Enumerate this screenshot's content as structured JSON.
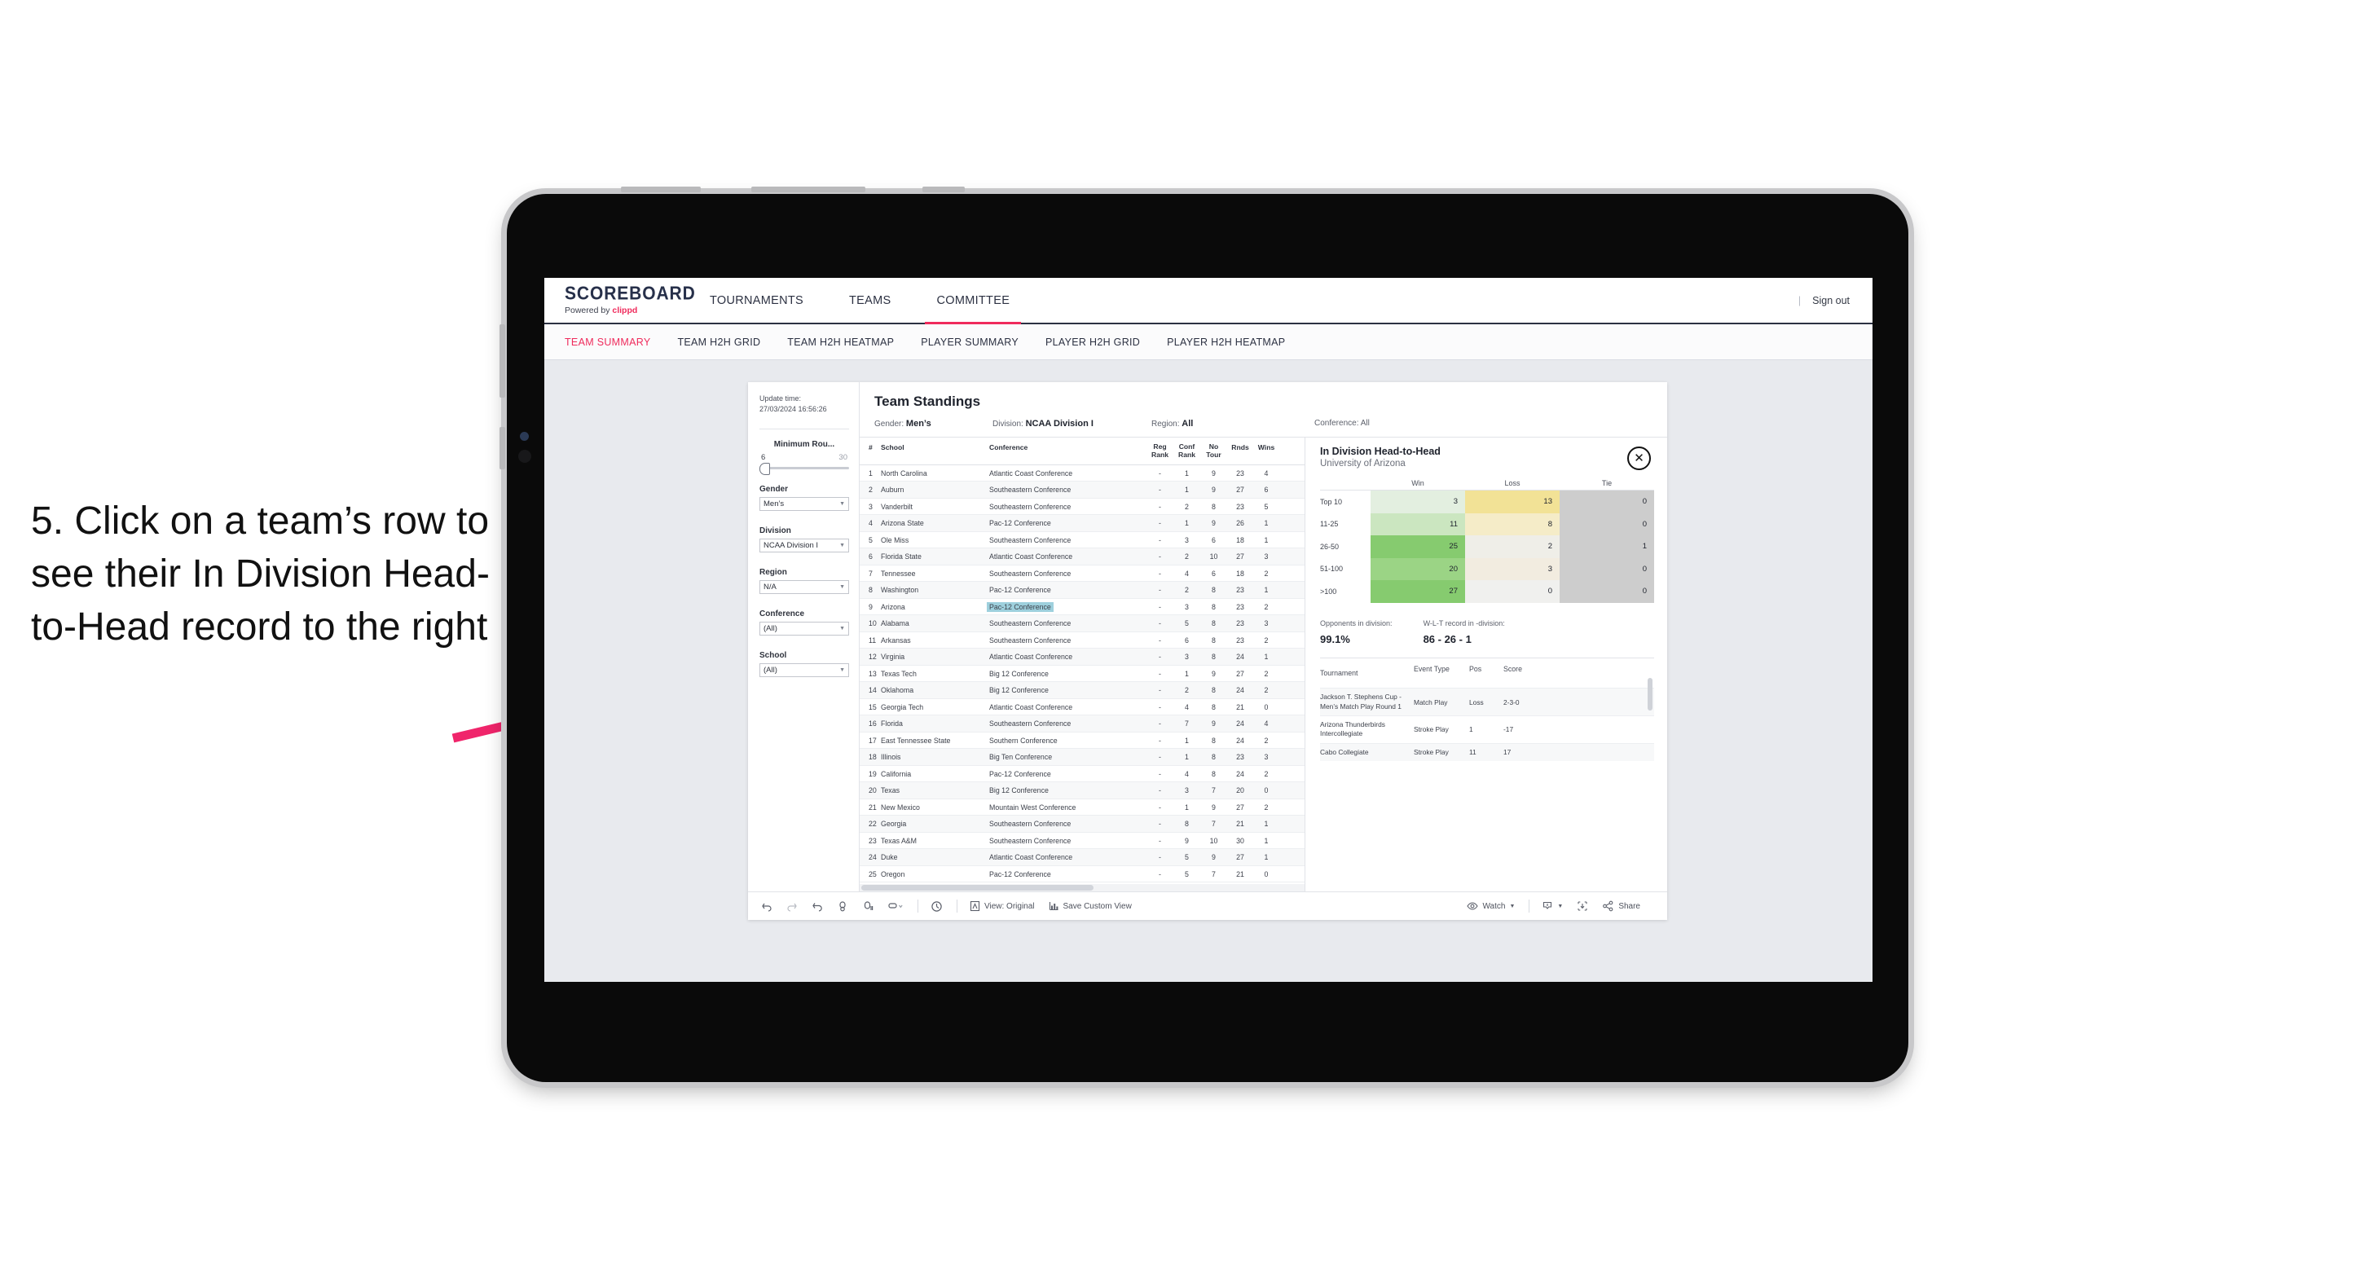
{
  "annotation": {
    "text": "5. Click on a team’s row to see their In Division Head-to-Head record to the right",
    "arrow_color": "#f0256b"
  },
  "topnav": {
    "logo_main": "SCOREBOARD",
    "logo_sub_prefix": "Powered by ",
    "logo_sub_brand": "clippd",
    "items": [
      {
        "label": "TOURNAMENTS",
        "active": false
      },
      {
        "label": "TEAMS",
        "active": false
      },
      {
        "label": "COMMITTEE",
        "active": true
      }
    ],
    "divider": "|",
    "sign_out": "Sign out",
    "accent": "#ef2b5c"
  },
  "subnav": {
    "items": [
      {
        "label": "TEAM SUMMARY",
        "active": true
      },
      {
        "label": "TEAM H2H GRID",
        "active": false
      },
      {
        "label": "TEAM H2H HEATMAP",
        "active": false
      },
      {
        "label": "PLAYER SUMMARY",
        "active": false
      },
      {
        "label": "PLAYER H2H GRID",
        "active": false
      },
      {
        "label": "PLAYER H2H HEATMAP",
        "active": false
      }
    ]
  },
  "filters": {
    "update_time_label": "Update time:",
    "update_time_value": "27/03/2024 16:56:26",
    "slider": {
      "title": "Minimum Rou...",
      "min": "6",
      "max": "30"
    },
    "groups": [
      {
        "label": "Gender",
        "value": "Men’s"
      },
      {
        "label": "Division",
        "value": "NCAA Division I"
      },
      {
        "label": "Region",
        "value": "N/A"
      },
      {
        "label": "Conference",
        "value": "(All)"
      },
      {
        "label": "School",
        "value": "(All)"
      }
    ]
  },
  "standings": {
    "title": "Team Standings",
    "meta": [
      {
        "label": "Gender: ",
        "value": "Men’s"
      },
      {
        "label": "Division: ",
        "value": "NCAA Division I"
      },
      {
        "label": "Region: ",
        "value": "All"
      },
      {
        "label": "Conference: ",
        "value": "All"
      }
    ],
    "columns": [
      "#",
      "School",
      "Conference",
      "Reg Rank",
      "Conf Rank",
      "No Tour",
      "Rnds",
      "Wins"
    ],
    "rows": [
      {
        "rank": "1",
        "school": "North Carolina",
        "conference": "Atlantic Coast Conference",
        "reg": "-",
        "conf": "1",
        "notour": "9",
        "rnds": "23",
        "wins": "4",
        "selected": false
      },
      {
        "rank": "2",
        "school": "Auburn",
        "conference": "Southeastern Conference",
        "reg": "-",
        "conf": "1",
        "notour": "9",
        "rnds": "27",
        "wins": "6",
        "selected": false
      },
      {
        "rank": "3",
        "school": "Vanderbilt",
        "conference": "Southeastern Conference",
        "reg": "-",
        "conf": "2",
        "notour": "8",
        "rnds": "23",
        "wins": "5",
        "selected": false
      },
      {
        "rank": "4",
        "school": "Arizona State",
        "conference": "Pac-12 Conference",
        "reg": "-",
        "conf": "1",
        "notour": "9",
        "rnds": "26",
        "wins": "1",
        "selected": false
      },
      {
        "rank": "5",
        "school": "Ole Miss",
        "conference": "Southeastern Conference",
        "reg": "-",
        "conf": "3",
        "notour": "6",
        "rnds": "18",
        "wins": "1",
        "selected": false
      },
      {
        "rank": "6",
        "school": "Florida State",
        "conference": "Atlantic Coast Conference",
        "reg": "-",
        "conf": "2",
        "notour": "10",
        "rnds": "27",
        "wins": "3",
        "selected": false
      },
      {
        "rank": "7",
        "school": "Tennessee",
        "conference": "Southeastern Conference",
        "reg": "-",
        "conf": "4",
        "notour": "6",
        "rnds": "18",
        "wins": "2",
        "selected": false
      },
      {
        "rank": "8",
        "school": "Washington",
        "conference": "Pac-12 Conference",
        "reg": "-",
        "conf": "2",
        "notour": "8",
        "rnds": "23",
        "wins": "1",
        "selected": false
      },
      {
        "rank": "9",
        "school": "Arizona",
        "conference": "Pac-12 Conference",
        "reg": "-",
        "conf": "3",
        "notour": "8",
        "rnds": "23",
        "wins": "2",
        "selected": true
      },
      {
        "rank": "10",
        "school": "Alabama",
        "conference": "Southeastern Conference",
        "reg": "-",
        "conf": "5",
        "notour": "8",
        "rnds": "23",
        "wins": "3",
        "selected": false
      },
      {
        "rank": "11",
        "school": "Arkansas",
        "conference": "Southeastern Conference",
        "reg": "-",
        "conf": "6",
        "notour": "8",
        "rnds": "23",
        "wins": "2",
        "selected": false
      },
      {
        "rank": "12",
        "school": "Virginia",
        "conference": "Atlantic Coast Conference",
        "reg": "-",
        "conf": "3",
        "notour": "8",
        "rnds": "24",
        "wins": "1",
        "selected": false
      },
      {
        "rank": "13",
        "school": "Texas Tech",
        "conference": "Big 12 Conference",
        "reg": "-",
        "conf": "1",
        "notour": "9",
        "rnds": "27",
        "wins": "2",
        "selected": false
      },
      {
        "rank": "14",
        "school": "Oklahoma",
        "conference": "Big 12 Conference",
        "reg": "-",
        "conf": "2",
        "notour": "8",
        "rnds": "24",
        "wins": "2",
        "selected": false
      },
      {
        "rank": "15",
        "school": "Georgia Tech",
        "conference": "Atlantic Coast Conference",
        "reg": "-",
        "conf": "4",
        "notour": "8",
        "rnds": "21",
        "wins": "0",
        "selected": false
      },
      {
        "rank": "16",
        "school": "Florida",
        "conference": "Southeastern Conference",
        "reg": "-",
        "conf": "7",
        "notour": "9",
        "rnds": "24",
        "wins": "4",
        "selected": false
      },
      {
        "rank": "17",
        "school": "East Tennessee State",
        "conference": "Southern Conference",
        "reg": "-",
        "conf": "1",
        "notour": "8",
        "rnds": "24",
        "wins": "2",
        "selected": false
      },
      {
        "rank": "18",
        "school": "Illinois",
        "conference": "Big Ten Conference",
        "reg": "-",
        "conf": "1",
        "notour": "8",
        "rnds": "23",
        "wins": "3",
        "selected": false
      },
      {
        "rank": "19",
        "school": "California",
        "conference": "Pac-12 Conference",
        "reg": "-",
        "conf": "4",
        "notour": "8",
        "rnds": "24",
        "wins": "2",
        "selected": false
      },
      {
        "rank": "20",
        "school": "Texas",
        "conference": "Big 12 Conference",
        "reg": "-",
        "conf": "3",
        "notour": "7",
        "rnds": "20",
        "wins": "0",
        "selected": false
      },
      {
        "rank": "21",
        "school": "New Mexico",
        "conference": "Mountain West Conference",
        "reg": "-",
        "conf": "1",
        "notour": "9",
        "rnds": "27",
        "wins": "2",
        "selected": false
      },
      {
        "rank": "22",
        "school": "Georgia",
        "conference": "Southeastern Conference",
        "reg": "-",
        "conf": "8",
        "notour": "7",
        "rnds": "21",
        "wins": "1",
        "selected": false
      },
      {
        "rank": "23",
        "school": "Texas A&M",
        "conference": "Southeastern Conference",
        "reg": "-",
        "conf": "9",
        "notour": "10",
        "rnds": "30",
        "wins": "1",
        "selected": false
      },
      {
        "rank": "24",
        "school": "Duke",
        "conference": "Atlantic Coast Conference",
        "reg": "-",
        "conf": "5",
        "notour": "9",
        "rnds": "27",
        "wins": "1",
        "selected": false
      },
      {
        "rank": "25",
        "school": "Oregon",
        "conference": "Pac-12 Conference",
        "reg": "-",
        "conf": "5",
        "notour": "7",
        "rnds": "21",
        "wins": "0",
        "selected": false
      }
    ],
    "selected_highlight_color": "#9ed0dd"
  },
  "h2h": {
    "title": "In Division Head-to-Head",
    "subtitle": "University of Arizona",
    "close_icon": "close-icon",
    "stats": [
      {
        "label": "Opponents in division:",
        "value": "99.1%"
      },
      {
        "label": "W-L-T record in -division:",
        "value": "86 - 26 - 1"
      }
    ],
    "tournaments": {
      "columns": [
        "Tournament",
        "Event Type",
        "Pos",
        "Score"
      ],
      "rows": [
        {
          "name": "Jackson T. Stephens Cup - Men’s Match Play Round 1",
          "type": "Match Play",
          "pos": "Loss",
          "score": "2-3-0"
        },
        {
          "name": "Arizona Thunderbirds Intercollegiate",
          "type": "Stroke Play",
          "pos": "1",
          "score": "-17"
        },
        {
          "name": "Cabo Collegiate",
          "type": "Stroke Play",
          "pos": "11",
          "score": "17"
        }
      ]
    }
  },
  "chart_data": {
    "type": "heatmap",
    "title": "In Division Head-to-Head",
    "subtitle": "University of Arizona",
    "xlabel": "",
    "ylabel": "",
    "columns": [
      "Win",
      "Loss",
      "Tie"
    ],
    "categories": [
      "Top 10",
      "11-25",
      "26-50",
      "51-100",
      ">100"
    ],
    "values": [
      [
        3,
        13,
        0
      ],
      [
        11,
        8,
        0
      ],
      [
        25,
        2,
        1
      ],
      [
        20,
        3,
        0
      ],
      [
        27,
        0,
        0
      ]
    ],
    "cell_colors": [
      [
        "#e3efe0",
        "#f2e296",
        "#cdcdcd"
      ],
      [
        "#cbe6c0",
        "#f5ecc8",
        "#cdcdcd"
      ],
      [
        "#86cb6f",
        "#efeee8",
        "#cdcdcd"
      ],
      [
        "#9bd485",
        "#f2ece0",
        "#cdcdcd"
      ],
      [
        "#86cb6f",
        "#f0f0ee",
        "#cdcdcd"
      ]
    ],
    "grid": false,
    "legend": "none"
  },
  "toolbar": {
    "left_icons": [
      "undo-icon",
      "redo-icon",
      "revert-icon",
      "refresh-icon",
      "pause-icon",
      "highlight-icon"
    ],
    "view_label": "View: Original",
    "save_label": "Save Custom View",
    "watch_label": "Watch",
    "share_label": "Share",
    "alert_icon": "alert-icon",
    "download_icon": "download-icon",
    "fullscreen_icon": "fullscreen-icon"
  }
}
